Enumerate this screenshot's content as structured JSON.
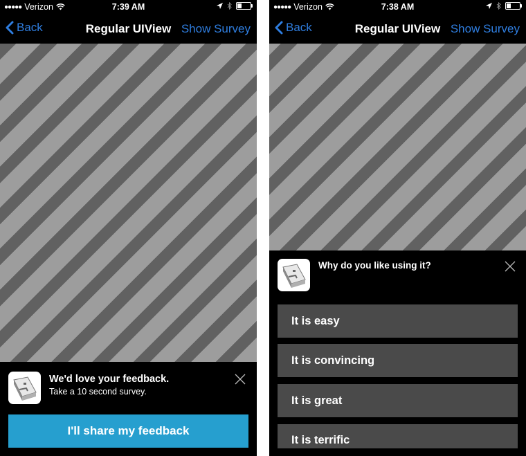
{
  "screens": [
    {
      "status": {
        "carrier": "Verizon",
        "signal_dots": "●●●●●",
        "time": "7:39 AM",
        "battery_level": 0.3
      },
      "nav": {
        "back_label": "Back",
        "title": "Regular UIView",
        "action_label": "Show Survey"
      },
      "prompt": {
        "title": "We'd love your feedback.",
        "subtitle": "Take a 10 second survey.",
        "cta_label": "I'll share my feedback"
      }
    },
    {
      "status": {
        "carrier": "Verizon",
        "signal_dots": "●●●●●",
        "time": "7:38 AM",
        "battery_level": 0.3
      },
      "nav": {
        "back_label": "Back",
        "title": "Regular UIView",
        "action_label": "Show Survey"
      },
      "survey": {
        "question": "Why do you like using it?",
        "answers": [
          "It is easy",
          "It is convincing",
          "It is great",
          "It is terrific"
        ]
      }
    }
  ],
  "colors": {
    "accent": "#2f7ee0",
    "cta": "#269fcf",
    "answer_bg": "#4a4a4a",
    "stripe_light": "#9d9d9d",
    "stripe_dark": "#616161"
  }
}
